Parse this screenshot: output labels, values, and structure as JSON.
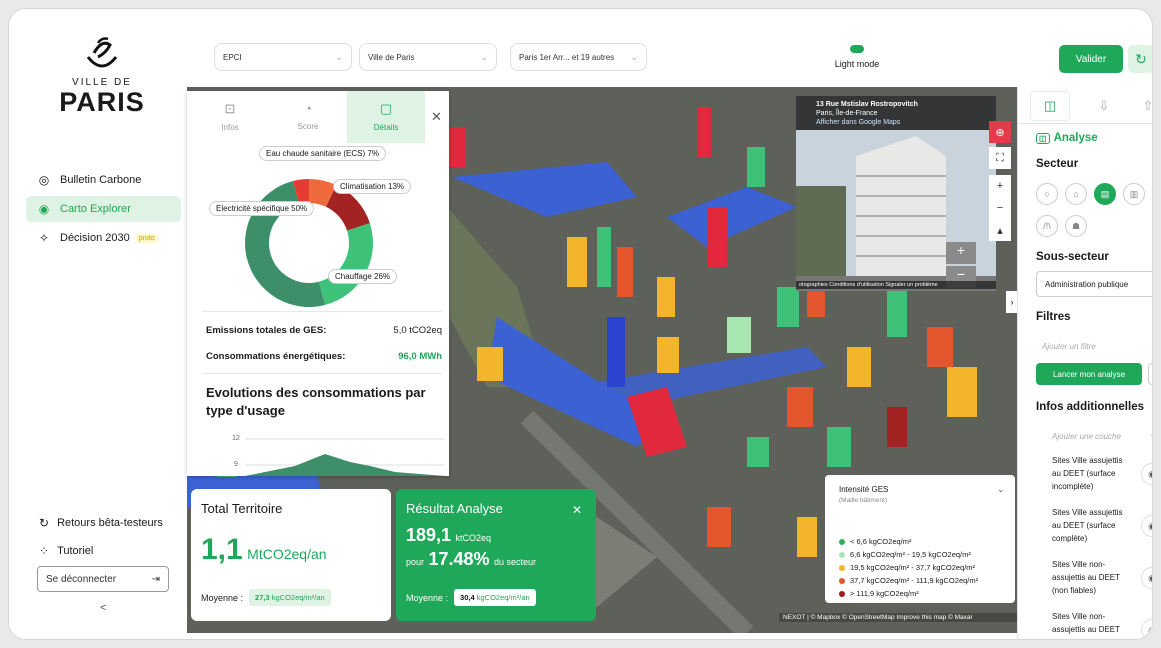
{
  "brand": {
    "line1": "VILLE DE",
    "line2": "PARIS"
  },
  "nav": [
    {
      "label": "Bulletin Carbone",
      "icon": "target-icon"
    },
    {
      "label": "Carto Explorer",
      "icon": "location-icon",
      "active": true
    },
    {
      "label": "Décision 2030",
      "icon": "compass-icon",
      "badge": "proto"
    }
  ],
  "bottom_nav": {
    "feedback": "Retours bêta-testeurs",
    "tutorial": "Tutoriel",
    "logout": "Se déconnecter",
    "collapse": "<"
  },
  "topbar": {
    "selects": [
      {
        "value": "EPCI"
      },
      {
        "value": "Ville de Paris"
      },
      {
        "value": "Paris 1er Arr... et 19 autres"
      }
    ],
    "light_mode": "Light mode",
    "validate": "Valider"
  },
  "details_panel": {
    "tabs": [
      {
        "label": "Infos"
      },
      {
        "label": "Score"
      },
      {
        "label": "Détails",
        "active": true
      }
    ],
    "donut": {
      "slices": [
        {
          "label": "Eau chaude sanitaire (ECS) 7%",
          "value": 7,
          "color": "#ee6a3c"
        },
        {
          "label": "Climatisation 13%",
          "value": 13,
          "color": "#a32222"
        },
        {
          "label": "Chauffage 26%",
          "value": 26,
          "color": "#3ec27a"
        },
        {
          "label": "Electricité spécifique 50%",
          "value": 50,
          "color": "#3d8f69"
        },
        {
          "value": 4,
          "color": "#e63b30"
        }
      ]
    },
    "emissions_label": "Emissions totales de GES:",
    "emissions_value": "5,0 tCO2eq",
    "conso_label": "Consommations énergétiques:",
    "conso_value": "96,0 MWh",
    "evolution_title": "Evolutions des consommations par type d'usage",
    "evolution_ticks": [
      "12",
      "9"
    ]
  },
  "total_card": {
    "title": "Total Territoire",
    "value": "1,1",
    "unit": "MtCO2eq/an",
    "avg_label": "Moyenne :",
    "avg_value": "27,3",
    "avg_unit": "kgCO2eq/m²/an"
  },
  "result_card": {
    "title": "Résultat Analyse",
    "value": "189,1",
    "unit": "ktCO2eq",
    "prefix": "pour",
    "pct": "17.48%",
    "suffix": "du secteur",
    "avg_label": "Moyenne :",
    "avg_value": "30,4",
    "avg_unit": "kgCO2eq/m²/an"
  },
  "streetview": {
    "address": "13 Rue Mstislav Rostropovitch",
    "city": "Paris, Île-de-France",
    "link": "Afficher dans Google Maps",
    "footer": "otographies Conditions d'utilisation Signaler un problème"
  },
  "legend": {
    "title": "Intensité GES",
    "subtitle": "(Maille bâtiment)",
    "items": [
      {
        "label": "< 6,6 kgCO2eq/m²",
        "color": "#2fae5c"
      },
      {
        "label": "6,6 kgCO2eq/m² - 19,5 kgCO2eq/m²",
        "color": "#a8e6b0"
      },
      {
        "label": "19,5 kgCO2eq/m² - 37,7 kgCO2eq/m²",
        "color": "#f3b52c"
      },
      {
        "label": "37,7 kgCO2eq/m² - 111,9 kgCO2eq/m²",
        "color": "#e4572e"
      },
      {
        "label": "> 111,9 kgCO2eq/m²",
        "color": "#a31818"
      }
    ]
  },
  "map_attribution": "NEXOT | © Mapbox © OpenStreetMap Improve this map © Maxar",
  "right_panel": {
    "analyse_title": "Analyse",
    "secteur": "Secteur",
    "sous_secteur": "Sous-secteur",
    "sous_secteur_value": "Administration publique",
    "filtres": "Filtres",
    "filter_placeholder": "Ajouter un filtre",
    "launch": "Lancer mon analyse",
    "infos_add": "Infos additionnelles",
    "layer_placeholder": "Ajouter une couche",
    "layers": [
      {
        "label": "Sites Ville assujettis au DEET (surface incomplète)"
      },
      {
        "label": "Sites Ville assujettis au DEET (surface complète)"
      },
      {
        "label": "Sites Ville non-assujettis au DEET (non fiables)"
      },
      {
        "label": "Sites Ville non-assujettis au DEET"
      }
    ]
  }
}
